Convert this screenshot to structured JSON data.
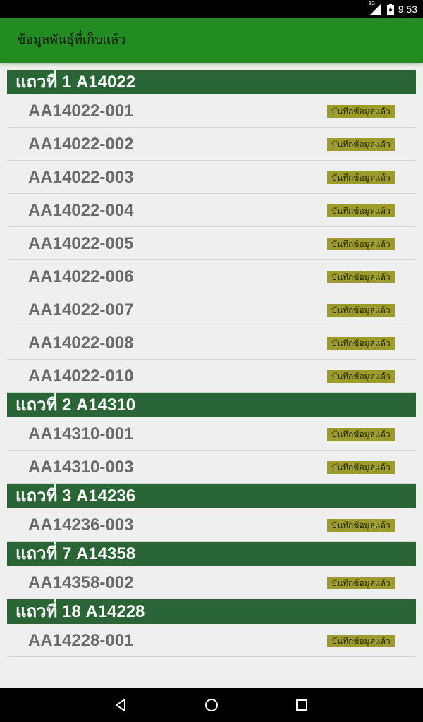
{
  "status_bar": {
    "network": "3G",
    "time": "9:53"
  },
  "app_bar": {
    "title": "ข้อมูลพันธุ์ที่เก็บแล้ว"
  },
  "rows": [
    {
      "header": "แถวที่ 1 A14022",
      "items": [
        {
          "code": "AA14022-001",
          "status": "บันทึกข้อมูลแล้ว"
        },
        {
          "code": "AA14022-002",
          "status": "บันทึกข้อมูลแล้ว"
        },
        {
          "code": "AA14022-003",
          "status": "บันทึกข้อมูลแล้ว"
        },
        {
          "code": "AA14022-004",
          "status": "บันทึกข้อมูลแล้ว"
        },
        {
          "code": "AA14022-005",
          "status": "บันทึกข้อมูลแล้ว"
        },
        {
          "code": "AA14022-006",
          "status": "บันทึกข้อมูลแล้ว"
        },
        {
          "code": "AA14022-007",
          "status": "บันทึกข้อมูลแล้ว"
        },
        {
          "code": "AA14022-008",
          "status": "บันทึกข้อมูลแล้ว"
        },
        {
          "code": "AA14022-010",
          "status": "บันทึกข้อมูลแล้ว"
        }
      ]
    },
    {
      "header": "แถวที่ 2 A14310",
      "items": [
        {
          "code": "AA14310-001",
          "status": "บันทึกข้อมูลแล้ว"
        },
        {
          "code": "AA14310-003",
          "status": "บันทึกข้อมูลแล้ว"
        }
      ]
    },
    {
      "header": "แถวที่ 3 A14236",
      "items": [
        {
          "code": "AA14236-003",
          "status": "บันทึกข้อมูลแล้ว"
        }
      ]
    },
    {
      "header": "แถวที่ 7 A14358",
      "items": [
        {
          "code": "AA14358-002",
          "status": "บันทึกข้อมูลแล้ว"
        }
      ]
    },
    {
      "header": "แถวที่ 18 A14228",
      "items": [
        {
          "code": "AA14228-001",
          "status": "บันทึกข้อมูลแล้ว"
        }
      ]
    }
  ],
  "colors": {
    "app_bar": "#228b22",
    "row_header": "#2a6535",
    "status_badge": "#9d9b2b",
    "background": "#efefef"
  },
  "icons": {
    "signal": "cell-signal-icon",
    "battery": "battery-icon",
    "back": "back-triangle-icon",
    "home": "home-circle-icon",
    "recents": "recents-square-icon"
  }
}
